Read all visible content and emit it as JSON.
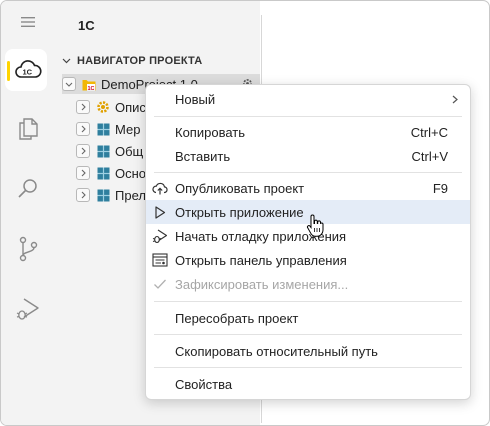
{
  "sidebar": {
    "title": "1С",
    "section": "НАВИГАТОР ПРОЕКТА",
    "tree": [
      {
        "label": "DemoProject 1.0",
        "icon": "project-icon"
      },
      {
        "label": "Опис",
        "icon": "gear-icon"
      },
      {
        "label": "Мер",
        "icon": "grid-icon"
      },
      {
        "label": "Общ",
        "icon": "grid-icon"
      },
      {
        "label": "Осно",
        "icon": "grid-icon"
      },
      {
        "label": "Прел",
        "icon": "grid-icon"
      }
    ]
  },
  "activity_bar": {
    "items": [
      "menu-icon",
      "1c-cloud-icon",
      "explorer-icon",
      "search-icon",
      "source-control-icon",
      "run-debug-icon"
    ],
    "active_accent": "#ffd400"
  },
  "context_menu": {
    "items": [
      {
        "label": "Новый",
        "shortcut": "",
        "submenu": true
      },
      {
        "label": "Копировать",
        "shortcut": "Ctrl+C"
      },
      {
        "label": "Вставить",
        "shortcut": "Ctrl+V"
      },
      {
        "label": "Опубликовать проект",
        "shortcut": "F9",
        "icon": "cloud-upload-icon"
      },
      {
        "label": "Открыть приложение",
        "shortcut": "",
        "icon": "play-icon",
        "highlighted": true
      },
      {
        "label": "Начать отладку приложения",
        "shortcut": "",
        "icon": "debug-icon"
      },
      {
        "label": "Открыть панель управления",
        "shortcut": "",
        "icon": "control-panel-icon"
      },
      {
        "label": "Зафиксировать изменения...",
        "shortcut": "",
        "icon": "check-icon",
        "disabled": true
      },
      {
        "label": "Пересобрать проект",
        "shortcut": ""
      },
      {
        "label": "Скопировать относительный путь",
        "shortcut": ""
      },
      {
        "label": "Свойства",
        "shortcut": ""
      }
    ],
    "highlight_color": "#e4ecf7"
  }
}
